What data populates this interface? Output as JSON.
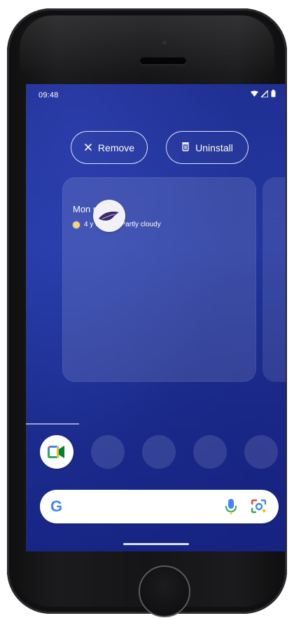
{
  "status": {
    "time": "09:48",
    "icons": [
      "wifi-icon",
      "signal-icon",
      "battery-icon"
    ]
  },
  "actions": {
    "remove_label": "Remove",
    "uninstall_label": "Uninstall"
  },
  "widget": {
    "title": "Mon             r",
    "weather_line": "4         y 9° / 4° · Partly cloudy"
  },
  "search": {
    "google_letter": "G"
  },
  "colors": {
    "wallpaper": "#1f2f92",
    "card": "rgba(255,255,255,0.12)",
    "search_bg": "#ffffff"
  }
}
